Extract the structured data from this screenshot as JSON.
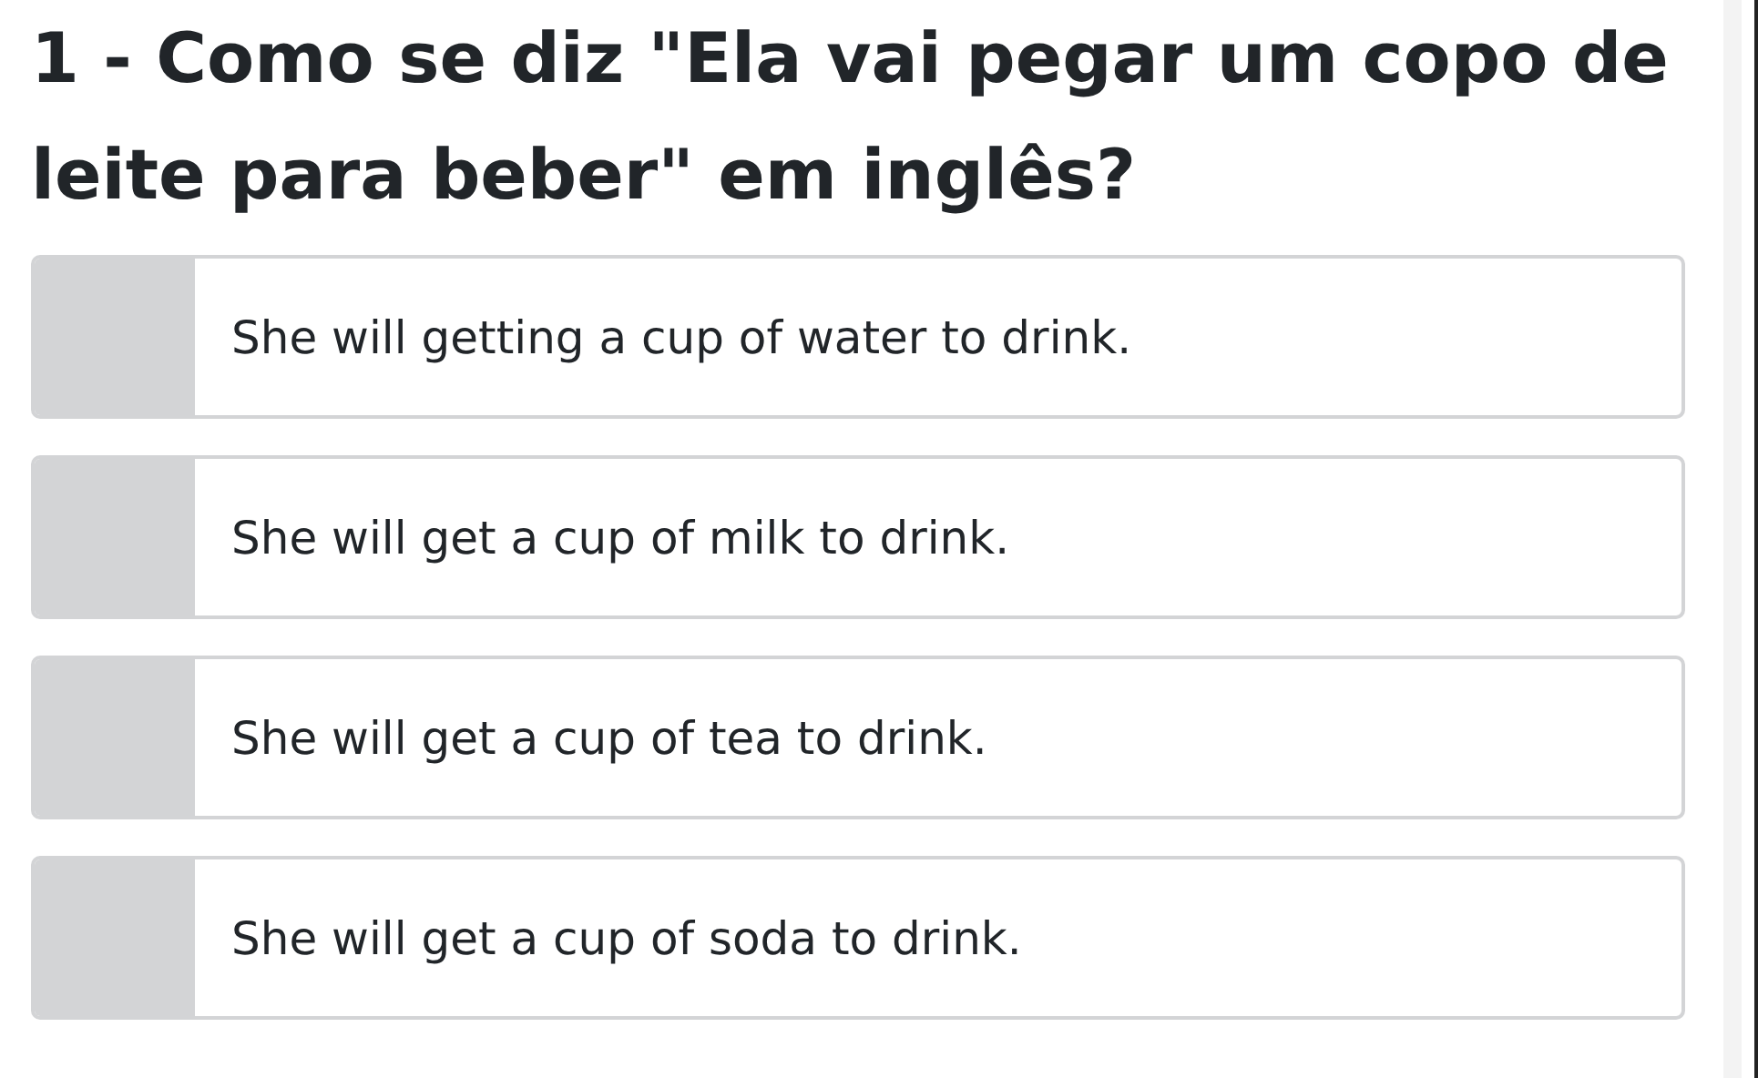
{
  "question": "1 - Como se diz \"Ela vai pegar um copo de leite para beber\" em inglês?",
  "options": [
    {
      "label": "She will getting a cup of water to drink."
    },
    {
      "label": "She will get a cup of milk to drink."
    },
    {
      "label": "She will get a cup of tea to drink."
    },
    {
      "label": "She will get a cup of soda to drink."
    }
  ]
}
